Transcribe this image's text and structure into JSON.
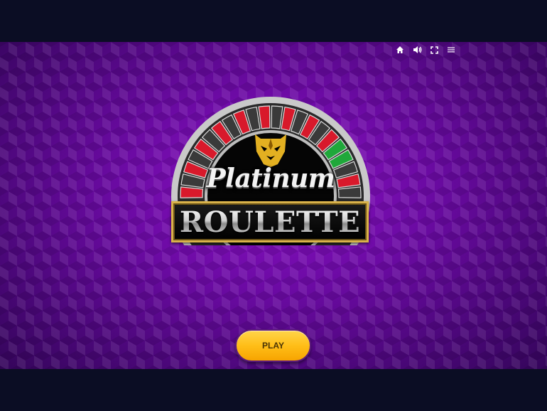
{
  "game": {
    "title_script": "Platinum",
    "title_banner": "ROULETTE"
  },
  "toolbar": {
    "items": [
      {
        "icon": "home-icon"
      },
      {
        "icon": "volume-icon"
      },
      {
        "icon": "fullscreen-icon"
      },
      {
        "icon": "menu-icon"
      }
    ]
  },
  "actions": {
    "play_label": "PLAY"
  },
  "colors": {
    "background": "#6b0aa3",
    "letterbox": "#0b0d24",
    "play_button": "#ffbe18",
    "wheel_red": "#d8192b",
    "wheel_green": "#1fa83a",
    "gold": "#d9b24a"
  }
}
